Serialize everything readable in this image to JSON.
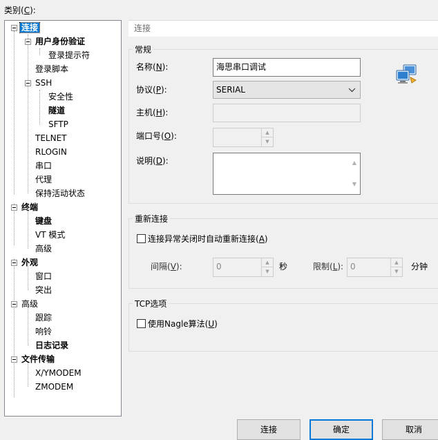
{
  "category_label": "类别(C):",
  "category_label_parts": {
    "pre": "类别(",
    "key": "C",
    "post": "):"
  },
  "tree": [
    {
      "label": "连接"
    },
    {
      "label": "用户身份验证"
    },
    {
      "label": "登录提示符"
    },
    {
      "label": "登录脚本"
    },
    {
      "label": "SSH"
    },
    {
      "label": "安全性"
    },
    {
      "label": "隧道"
    },
    {
      "label": "SFTP"
    },
    {
      "label": "TELNET"
    },
    {
      "label": "RLOGIN"
    },
    {
      "label": "串口"
    },
    {
      "label": "代理"
    },
    {
      "label": "保持活动状态"
    },
    {
      "label": "终端"
    },
    {
      "label": "键盘"
    },
    {
      "label": "VT 模式"
    },
    {
      "label": "高级"
    },
    {
      "label": "外观"
    },
    {
      "label": "窗口"
    },
    {
      "label": "突出"
    },
    {
      "label": "高级"
    },
    {
      "label": "跟踪"
    },
    {
      "label": "响铃"
    },
    {
      "label": "日志记录"
    },
    {
      "label": "文件传输"
    },
    {
      "label": "X/YMODEM"
    },
    {
      "label": "ZMODEM"
    }
  ],
  "panel": {
    "header": "连接",
    "general": {
      "title": "常规",
      "name_label": {
        "pre": "名称(",
        "key": "N",
        "post": "):"
      },
      "name_value": "海思串口调试",
      "protocol_label": {
        "pre": "协议(",
        "key": "P",
        "post": "):"
      },
      "protocol_value": "SERIAL",
      "host_label": {
        "pre": "主机(",
        "key": "H",
        "post": "):"
      },
      "host_value": "",
      "port_label": {
        "pre": "端口号(",
        "key": "O",
        "post": "):"
      },
      "port_value": "",
      "desc_label": {
        "pre": "说明(",
        "key": "D",
        "post": "):"
      },
      "desc_value": ""
    },
    "reconnect": {
      "title": "重新连接",
      "checkbox_label": {
        "pre": "连接异常关闭时自动重新连接(",
        "key": "A",
        "post": ")"
      },
      "checked": false,
      "interval_label": {
        "pre": "间隔(",
        "key": "V",
        "post": "):"
      },
      "interval_value": "0",
      "interval_unit": "秒",
      "limit_label": {
        "pre": "限制(",
        "key": "L",
        "post": "):"
      },
      "limit_value": "0",
      "limit_unit": "分钟"
    },
    "tcp": {
      "title": "TCP选项",
      "nagle_label": {
        "pre": "使用Nagle算法(",
        "key": "U",
        "post": ")"
      },
      "checked": false
    }
  },
  "buttons": {
    "connect": "连接",
    "ok": "确定",
    "cancel": "取消"
  }
}
